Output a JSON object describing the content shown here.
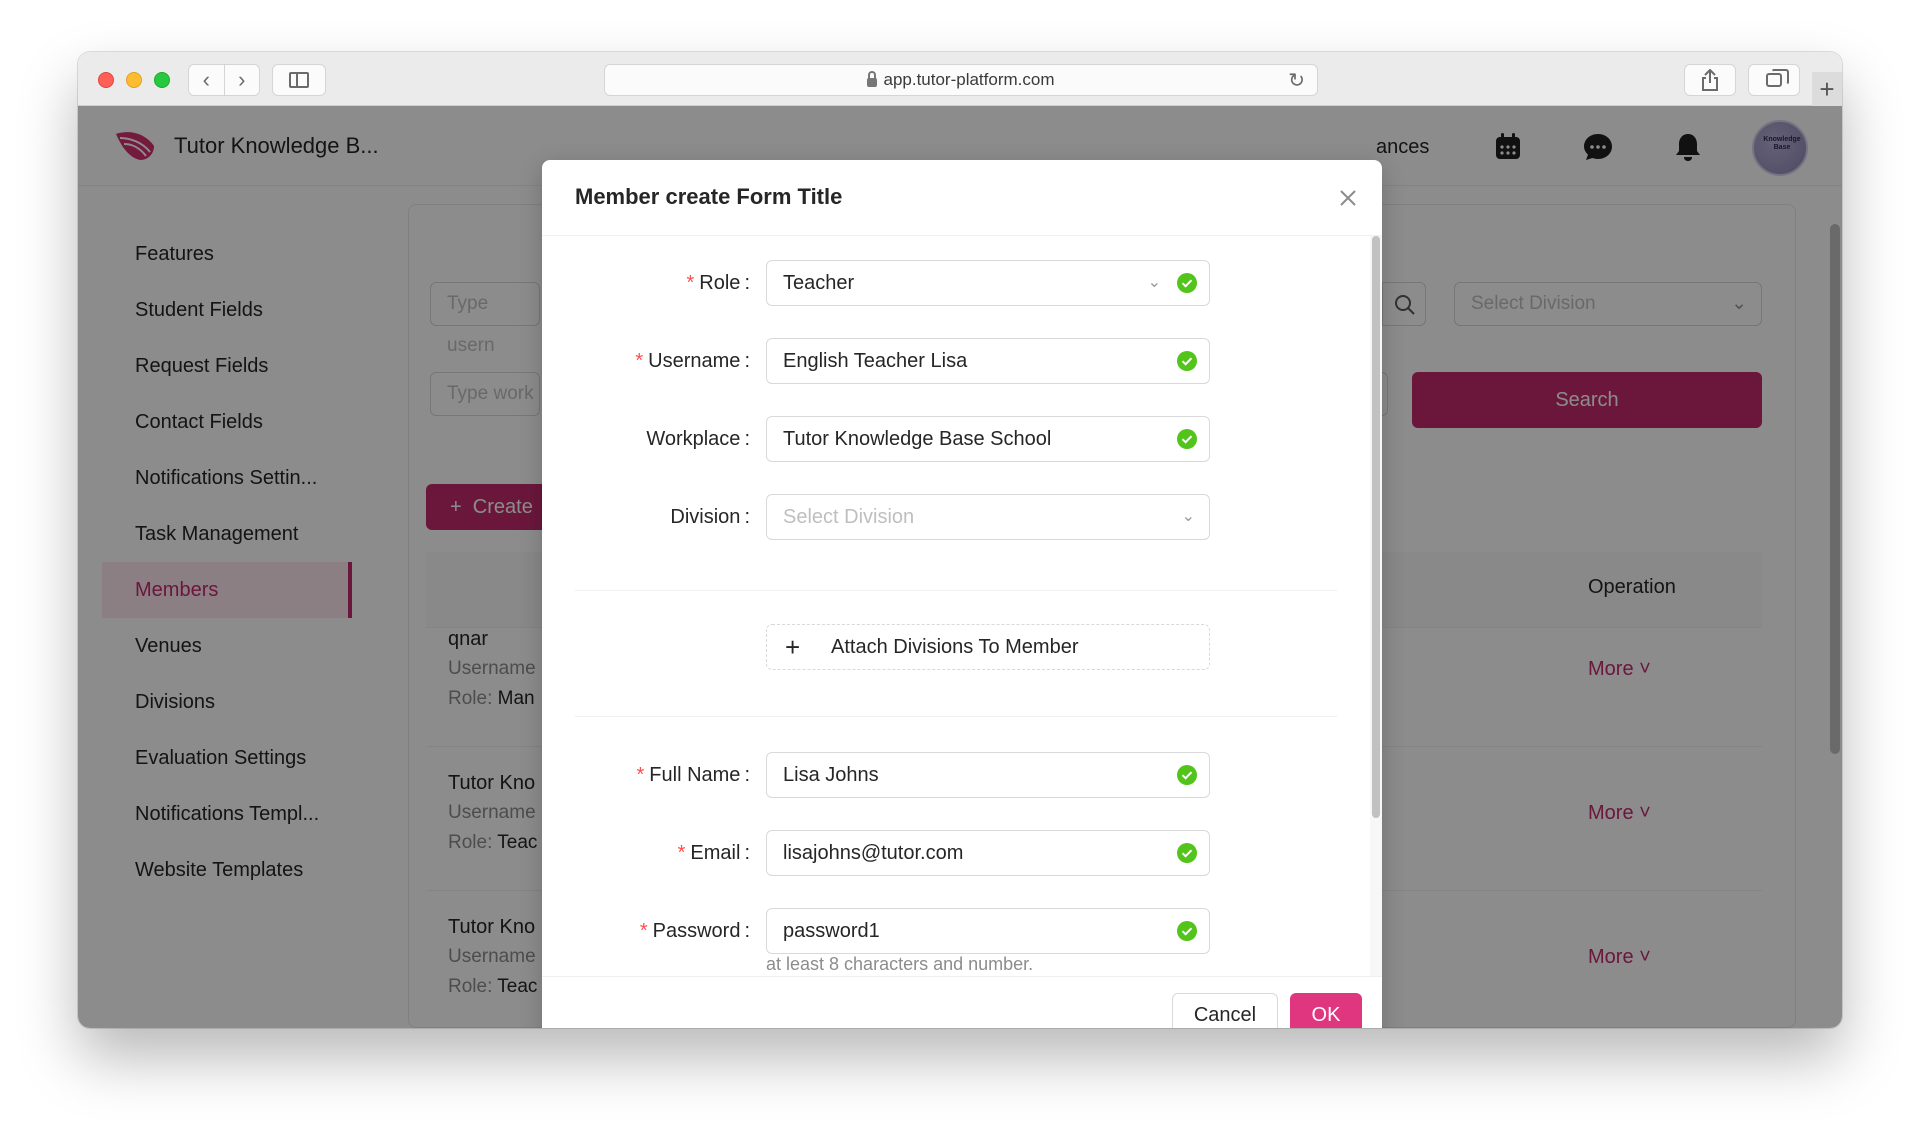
{
  "browser": {
    "url": "app.tutor-platform.com"
  },
  "header": {
    "brand": "Tutor Knowledge B...",
    "nav_tail": "ances",
    "avatar_text": "Knowledge Base"
  },
  "sidebar": {
    "items": [
      {
        "label": "Features"
      },
      {
        "label": "Student Fields"
      },
      {
        "label": "Request Fields"
      },
      {
        "label": "Contact Fields"
      },
      {
        "label": "Notifications Settin..."
      },
      {
        "label": "Task Management"
      },
      {
        "label": "Members"
      },
      {
        "label": "Venues"
      },
      {
        "label": "Divisions"
      },
      {
        "label": "Evaluation Settings"
      },
      {
        "label": "Notifications Templ..."
      },
      {
        "label": "Website Templates"
      }
    ],
    "active_index": 6
  },
  "filters": {
    "username_placeholder": "Type usern",
    "workplace_placeholder": "Type work",
    "division_placeholder": "Select Division",
    "search_label": "Search",
    "create_label": "Create"
  },
  "table": {
    "operation_header": "Operation",
    "rows": [
      {
        "name": "qnar",
        "username_label": "Username",
        "role_label": "Role:",
        "role_value": "Man",
        "action": "More"
      },
      {
        "name": "Tutor Kno",
        "username_label": "Username",
        "role_label": "Role:",
        "role_value": "Teac",
        "action": "More"
      },
      {
        "name": "Tutor Kno",
        "username_label": "Username",
        "role_label": "Role:",
        "role_value": "Teac",
        "action": "More"
      }
    ]
  },
  "modal": {
    "title": "Member create Form Title",
    "fields": {
      "role": {
        "label": "Role",
        "value": "Teacher"
      },
      "username": {
        "label": "Username",
        "value": "English Teacher Lisa"
      },
      "workplace": {
        "label": "Workplace",
        "value": "Tutor Knowledge Base School"
      },
      "division": {
        "label": "Division",
        "placeholder": "Select Division"
      },
      "full_name": {
        "label": "Full Name",
        "value": "Lisa Johns"
      },
      "email": {
        "label": "Email",
        "value": "lisajohns@tutor.com"
      },
      "password": {
        "label": "Password",
        "value": "password1",
        "hint": "at least 8 characters and number."
      }
    },
    "attach_label": "Attach Divisions To Member",
    "cancel_label": "Cancel",
    "ok_label": "OK"
  },
  "colors": {
    "accent": "#c32b6c",
    "ok_button": "#e0367f",
    "success": "#52c41a",
    "required": "#ff4d4f"
  }
}
